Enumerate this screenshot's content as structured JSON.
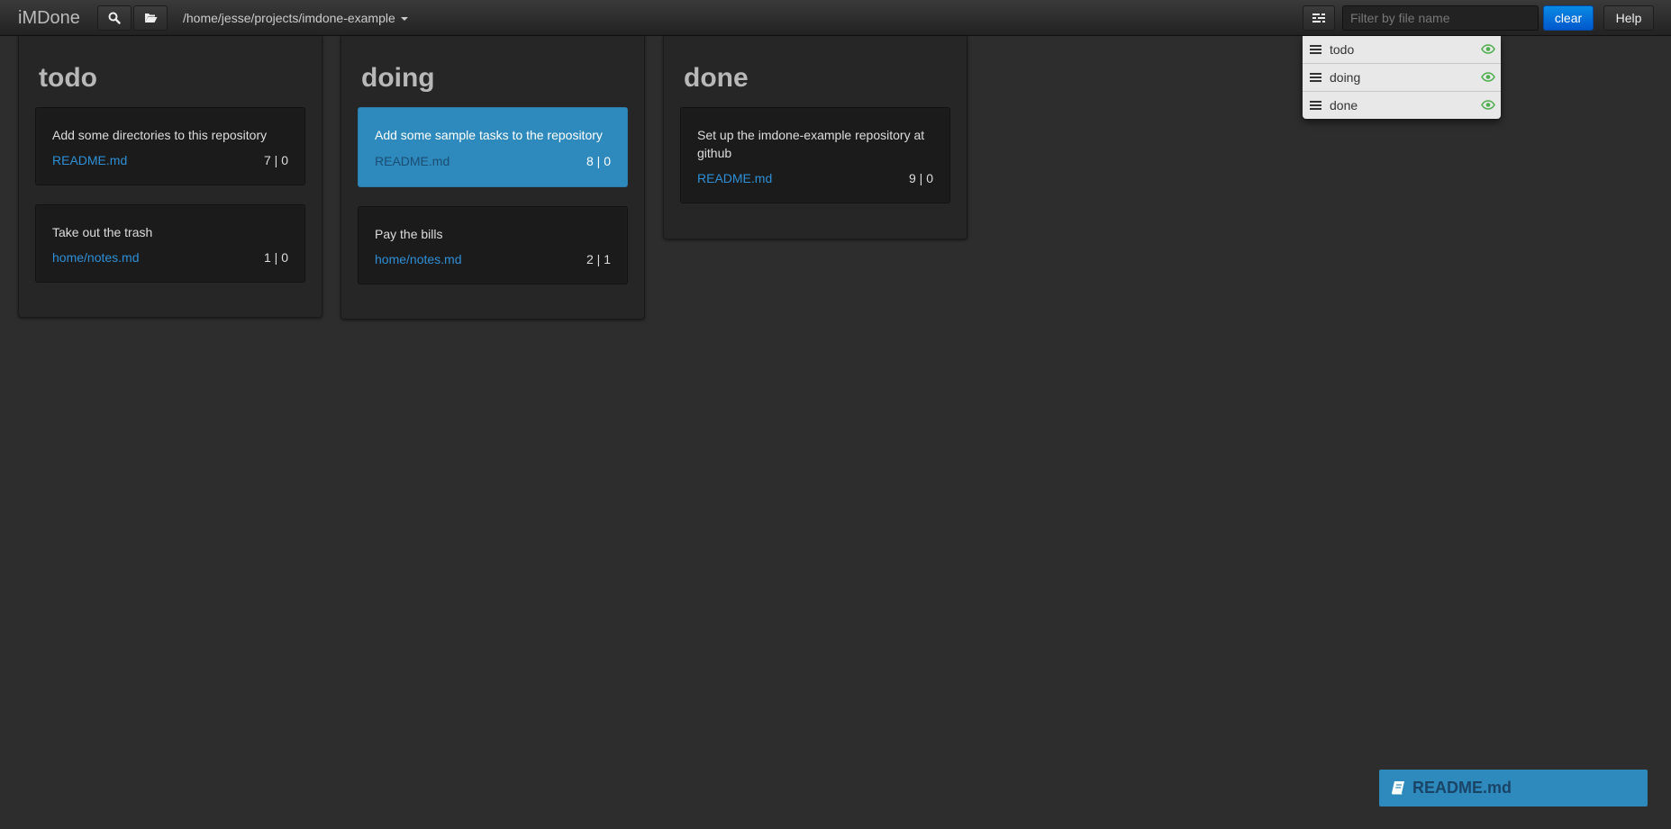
{
  "app": {
    "title": "iMDone"
  },
  "navbar": {
    "project_path": "/home/jesse/projects/imdone-example",
    "filter_placeholder": "Filter by file name",
    "filter_value": "",
    "clear_label": "clear",
    "help_label": "Help"
  },
  "lists_menu": {
    "items": [
      {
        "label": "todo",
        "visible": true
      },
      {
        "label": "doing",
        "visible": true
      },
      {
        "label": "done",
        "visible": true
      }
    ]
  },
  "board": {
    "columns": [
      {
        "title": "todo",
        "cards": [
          {
            "text": "Add some directories to this repository",
            "file": "README.md",
            "count": "7 | 0"
          },
          {
            "text": "Take out the trash",
            "file": "home/notes.md",
            "count": "1 | 0"
          }
        ]
      },
      {
        "title": "doing",
        "cards": [
          {
            "text": "Add some sample tasks to the repository",
            "file": "README.md",
            "count": "8 | 0",
            "selected": true
          },
          {
            "text": "Pay the bills",
            "file": "home/notes.md",
            "count": "2 | 1"
          }
        ]
      },
      {
        "title": "done",
        "cards": [
          {
            "text": "Set up the imdone-example repository at github",
            "file": "README.md",
            "count": "9 | 0"
          }
        ]
      }
    ]
  },
  "readme_bar": {
    "label": "README.md"
  },
  "colors": {
    "accent": "#2e8abd",
    "link": "#2e8fd6",
    "eye": "#4cae4c",
    "clear_button": "#0a74dc"
  }
}
